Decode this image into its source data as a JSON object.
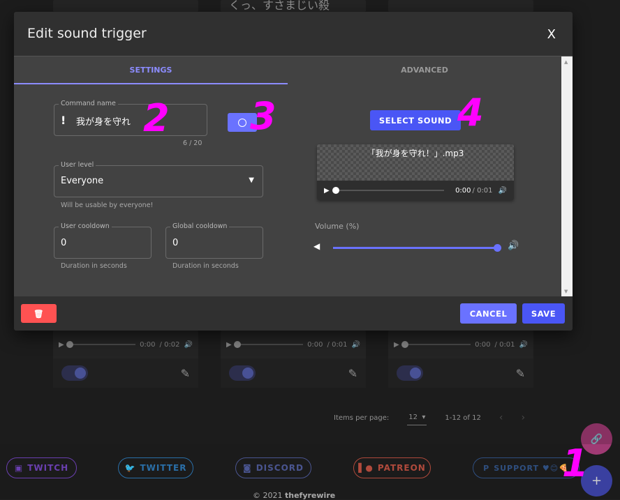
{
  "background_cards": {
    "top_title": "くっ、すさまじい殺",
    "bottom": [
      {
        "time": "0:00",
        "duration": "/ 0:02"
      },
      {
        "time": "0:00",
        "duration": "/ 0:01"
      },
      {
        "time": "0:00",
        "duration": "/ 0:01"
      }
    ]
  },
  "pagination": {
    "items_per_page_label": "Items per page:",
    "items_per_page": "12",
    "range": "1-12 of 12"
  },
  "footer": {
    "links": [
      {
        "label": "TWITCH",
        "color": "#6a3fb0"
      },
      {
        "label": "TWITTER",
        "color": "#2a6fa8"
      },
      {
        "label": "DISCORD",
        "color": "#4a5590"
      },
      {
        "label": "PATREON",
        "color": "#b04a3c"
      },
      {
        "label": "SUPPORT ♥😊🍕",
        "color": "#2f4f80"
      }
    ],
    "copyright": "© 2021",
    "author": "thefyrewire"
  },
  "modal": {
    "title": "Edit sound trigger",
    "close": "X",
    "tabs": [
      "SETTINGS",
      "ADVANCED"
    ],
    "active_tab": "SETTINGS",
    "command_name": {
      "label": "Command name",
      "prefix": "!",
      "value": "我が身を守れ",
      "counter": "6 / 20"
    },
    "user_level": {
      "label": "User level",
      "value": "Everyone",
      "hint": "Will be usable by everyone!"
    },
    "user_cooldown": {
      "label": "User cooldown",
      "value": "0",
      "hint": "Duration in seconds"
    },
    "global_cooldown": {
      "label": "Global cooldown",
      "value": "0",
      "hint": "Duration in seconds"
    },
    "select_sound": "SELECT SOUND",
    "player": {
      "filename": "「我が身を守れ！」.mp3",
      "time": "0:00",
      "duration": "/ 0:01"
    },
    "volume": {
      "label": "Volume (%)",
      "value": 100
    },
    "cancel": "CANCEL",
    "save": "SAVE"
  },
  "annotations": [
    "1",
    "2",
    "3",
    "4"
  ],
  "colors": {
    "accent": "#6a72ff",
    "primary": "#4a56f5",
    "danger": "#ff5252"
  }
}
